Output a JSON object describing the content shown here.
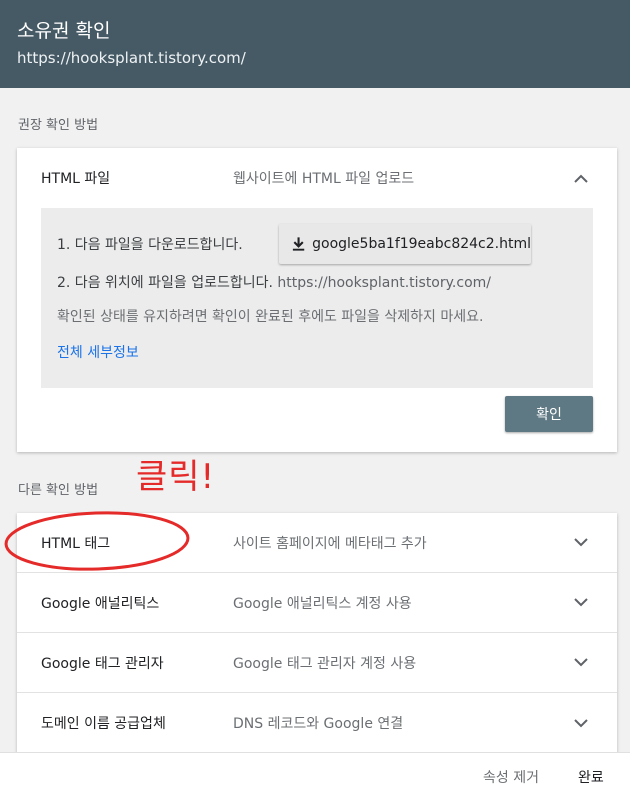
{
  "header": {
    "title": "소유권 확인",
    "url": "https://hooksplant.tistory.com/"
  },
  "recommended": {
    "section_label": "권장 확인 방법",
    "method_name": "HTML 파일",
    "method_desc": "웹사이트에 HTML 파일 업로드",
    "step1": "1. 다음 파일을 다운로드합니다.",
    "download_file": "google5ba1f19eabc824c2.html",
    "step2": "2. 다음 위치에 파일을 업로드합니다.",
    "upload_url": "https://hooksplant.tistory.com/",
    "note": "확인된 상태를 유지하려면 확인이 완료된 후에도 파일을 삭제하지 마세요.",
    "details_link": "전체 세부정보",
    "confirm_label": "확인"
  },
  "other": {
    "section_label": "다른 확인 방법",
    "methods": [
      {
        "name": "HTML 태그",
        "desc": "사이트 홈페이지에 메타태그 추가"
      },
      {
        "name": "Google 애널리틱스",
        "desc": "Google 애널리틱스 계정 사용"
      },
      {
        "name": "Google 태그 관리자",
        "desc": "Google 태그 관리자 계정 사용"
      },
      {
        "name": "도메인 이름 공급업체",
        "desc": "DNS 레코드와 Google 연결"
      }
    ]
  },
  "annotation": {
    "text": "클릭!",
    "color": "#e52a2a"
  },
  "footer": {
    "remove_label": "속성 제거",
    "done_label": "완료"
  },
  "colors": {
    "header_bg": "#465a65",
    "confirm_bg": "#5e7983",
    "link": "#1a73e8"
  },
  "icons": [
    "chevron-up-icon",
    "chevron-down-icon",
    "download-icon"
  ]
}
